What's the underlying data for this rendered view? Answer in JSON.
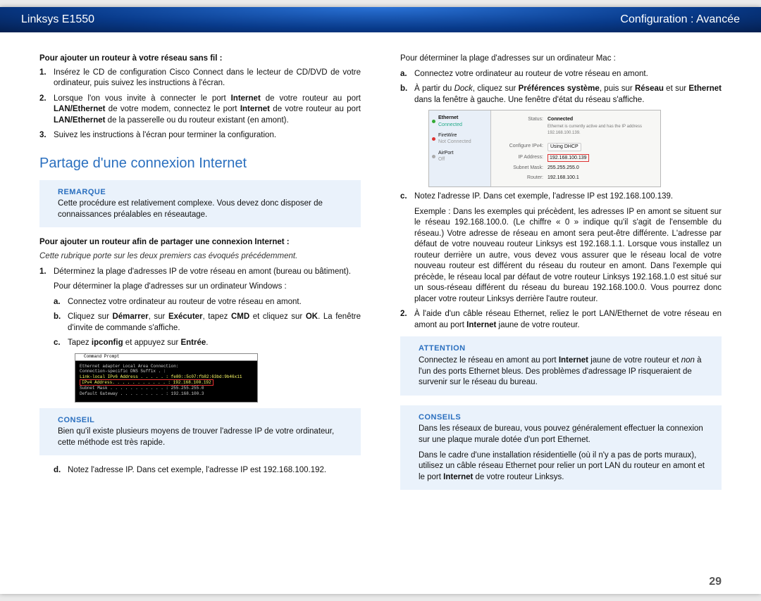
{
  "header": {
    "left": "Linksys E1550",
    "right": "Configuration : Avancée"
  },
  "left": {
    "intro1": "Pour ajouter un routeur à votre réseau sans fil :",
    "list1": [
      {
        "n": "1.",
        "html": "Insérez le CD de configuration Cisco Connect dans le lecteur de CD/DVD de votre ordinateur, puis suivez les instructions à l'écran."
      },
      {
        "n": "2.",
        "html": "Lorsque l'on vous invite à connecter le port <b>Internet</b> de votre routeur au port <b>LAN/Ethernet</b> de votre modem, connectez le port <b>Internet</b> de votre routeur au port <b>LAN/Ethernet</b> de la passerelle ou du routeur existant (en amont)."
      },
      {
        "n": "3.",
        "html": "Suivez les instructions à l'écran pour terminer la configuration."
      }
    ],
    "h2": "Partage d'une connexion Internet",
    "note1_title": "REMARQUE",
    "note1_body": "Cette procédure est relativement complexe. Vous devez donc disposer de connaissances préalables en réseautage.",
    "intro2": "Pour ajouter un routeur afin de partager une connexion Internet :",
    "intro2_sub": "Cette rubrique porte sur les deux premiers cas évoqués précédemment.",
    "list2_1": {
      "n": "1.",
      "html": "Déterminez la plage d'adresses IP de votre réseau en amont (bureau ou bâtiment)."
    },
    "windows_line": "Pour déterminer la plage d'adresses sur un ordinateur Windows :",
    "letters": [
      {
        "l": "a.",
        "html": "Connectez votre ordinateur au routeur de votre réseau en amont."
      },
      {
        "l": "b.",
        "html": "Cliquez sur <b>Démarrer</b>, sur <b>Exécuter</b>, tapez <b>CMD</b> et cliquez sur <b>OK</b>. La fenêtre d'invite de commande s'affiche."
      },
      {
        "l": "c.",
        "html": "Tapez <b>ipconfig</b> et appuyez sur <b>Entrée</b>."
      }
    ],
    "cmd_title": "Command Prompt",
    "cmd_lines": [
      "Ethernet adapter Local Area Connection:",
      "Connection-specific DNS Suffix  . :",
      "Link-local IPv6 Address . . . . . : fe80::5c07:fb82:63bd:9b46x11",
      "<span class='cmd-red'>IPv4 Address. . . . . . . . . . . : 192.168.100.192</span>",
      "Subnet Mask . . . . . . . . . . . : 255.255.255.0",
      "Default Gateway . . . . . . . . . : 192.168.100.3"
    ],
    "note2_title": "CONSEIL",
    "note2_body": "Bien qu'il existe plusieurs moyens de trouver l'adresse IP de votre ordinateur, cette méthode est très rapide.",
    "letter_d": {
      "l": "d.",
      "html": "Notez l'adresse IP. Dans cet exemple, l'adresse IP est 192.168.100.192."
    }
  },
  "right": {
    "mac_line": "Pour déterminer la plage d'adresses sur un ordinateur Mac :",
    "letters1": [
      {
        "l": "a.",
        "html": "Connectez votre ordinateur au routeur de votre réseau en amont."
      },
      {
        "l": "b.",
        "html": "À partir du <i>Dock</i>, cliquez sur <b>Préférences système</b>, puis sur <b>Réseau</b> et sur <b>Ethernet</b> dans la fenêtre à gauche. Une fenêtre d'état du réseau s'affiche."
      }
    ],
    "mac_panel": {
      "side": [
        {
          "dot": "g",
          "t1": "Ethernet",
          "t2": "Connected"
        },
        {
          "dot": "r",
          "t1": "FireWire",
          "t2": "Not Connected"
        },
        {
          "dot": "gray",
          "t1": "AirPort",
          "t2": "Off"
        }
      ],
      "status_lbl": "Status:",
      "status_val": "Connected",
      "status_sub": "Ethernet is currently active and has the IP address 192.168.100.139.",
      "rows": [
        {
          "lbl": "Configure IPv4:",
          "val": "Using DHCP",
          "sel": true
        },
        {
          "lbl": "IP Address:",
          "val": "192.168.100.139",
          "red": true
        },
        {
          "lbl": "Subnet Mask:",
          "val": "255.255.255.0"
        },
        {
          "lbl": "Router:",
          "val": "192.168.100.1"
        }
      ]
    },
    "letter_c": {
      "l": "c.",
      "html": "Notez l'adresse IP. Dans cet exemple, l'adresse IP est 192.168.100.139."
    },
    "exemple": "Exemple : Dans les exemples qui précèdent, les adresses IP en amont se situent sur le réseau 192.168.100.0. (Le chiffre « 0 » indique qu'il s'agit de l'ensemble du réseau.) Votre adresse de réseau en amont sera peut-être différente. L'adresse par défaut de votre nouveau routeur Linksys est 192.168.1.1. Lorsque vous installez un routeur derrière un autre, vous devez vous assurer que le réseau local de votre nouveau routeur est différent du réseau du routeur en amont. Dans l'exemple qui précède, le réseau local par défaut de votre routeur Linksys 192.168.1.0 est situé sur un sous-réseau différent du réseau du bureau 192.168.100.0. Vous pourrez donc placer votre routeur Linksys derrière l'autre routeur.",
    "list2_2": {
      "n": "2.",
      "html": "À l'aide d'un câble réseau Ethernet, reliez le port LAN/Ethernet de votre réseau en amont au port <b>Internet</b> jaune de votre routeur."
    },
    "att_title": "ATTENTION",
    "att_body": "Connectez le réseau en amont au port <b>Internet</b> jaune de votre routeur et <i>non</i> à l'un des ports Ethernet bleus. Des problèmes d'adressage IP risqueraient de survenir sur le réseau du bureau.",
    "cons_title": "CONSEILS",
    "cons_body1": "Dans les réseaux de bureau, vous pouvez généralement effectuer la connexion sur une plaque murale dotée d'un port Ethernet.",
    "cons_body2": "Dans le cadre d'une installation résidentielle (où il n'y a pas de ports muraux), utilisez un câble réseau Ethernet pour relier un port LAN du routeur en amont et le port <b>Internet</b> de votre routeur Linksys."
  },
  "page_number": "29"
}
